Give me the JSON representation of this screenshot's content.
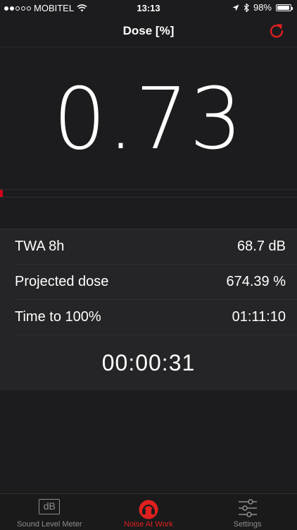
{
  "status_bar": {
    "carrier": "MOBITEL",
    "time": "13:13",
    "battery": "98%",
    "signal_bars_filled": 2,
    "signal_bars_total": 5,
    "battery_level": 0.98
  },
  "nav": {
    "title": "Dose [%]",
    "reset_icon": "refresh-icon"
  },
  "hero": {
    "value": "0.73"
  },
  "progress": {
    "fraction": 0.0073,
    "color": "#d0021b"
  },
  "stats": [
    {
      "label": "TWA 8h",
      "value": "68.7 dB"
    },
    {
      "label": "Projected dose",
      "value": "674.39 %"
    },
    {
      "label": "Time to 100%",
      "value": "01:11:10"
    }
  ],
  "timer": "00:00:31",
  "tabs": [
    {
      "label": "Sound Level Meter",
      "icon": "db-icon",
      "active": false
    },
    {
      "label": "Noise At Work",
      "icon": "ear-protection-icon",
      "active": true
    },
    {
      "label": "Settings",
      "icon": "sliders-icon",
      "active": false
    }
  ],
  "colors": {
    "accent": "#e0201f",
    "background": "#1c1c1e",
    "inactive": "#8e8e93"
  }
}
